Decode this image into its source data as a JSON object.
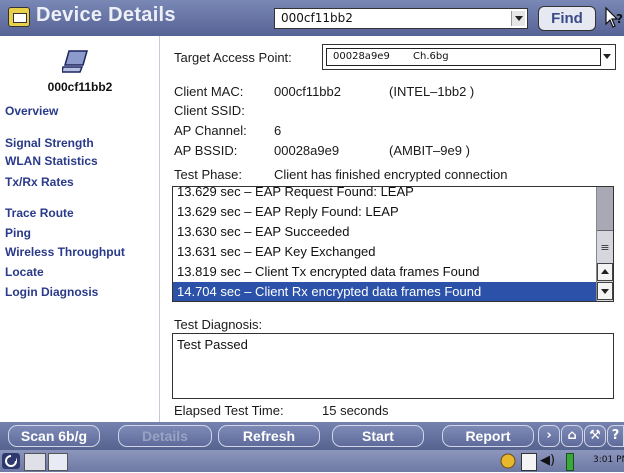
{
  "app": {
    "title": "Device Details",
    "device_select_value": "000cf11bb2",
    "find_label": "Find",
    "help_glyph": "?"
  },
  "sidebar": {
    "device_name": "000cf11bb2",
    "items": [
      {
        "label": "Overview"
      },
      {
        "label": "Signal Strength"
      },
      {
        "label": "WLAN Statistics"
      },
      {
        "label": "Tx/Rx Rates"
      },
      {
        "label": "Trace Route"
      },
      {
        "label": "Ping"
      },
      {
        "label": "Wireless Throughput"
      },
      {
        "label": "Locate"
      },
      {
        "label": "Login Diagnosis"
      }
    ]
  },
  "main": {
    "target_ap_label": "Target Access Point:",
    "target_ap_bssid": "00028a9e9",
    "target_ap_channel": "Ch.6bg",
    "fields": [
      {
        "label": "Client MAC:",
        "value": "000cf11bb2",
        "extra": "(INTEL–1bb2  )"
      },
      {
        "label": "Client SSID:",
        "value": "",
        "extra": ""
      },
      {
        "label": "AP Channel:",
        "value": "6",
        "extra": ""
      },
      {
        "label": "AP BSSID:",
        "value": "00028a9e9",
        "extra": "(AMBIT–9e9   )"
      }
    ],
    "test_phase_label": "Test Phase:",
    "test_phase_value": "Client has finished encrypted connection",
    "log": [
      "13.629 sec – EAP Request Found: LEAP",
      "13.629 sec – EAP Reply Found: LEAP",
      "13.630 sec – EAP Succeeded",
      "13.631 sec – EAP Key Exchanged",
      "13.819 sec – Client Tx encrypted data frames Found",
      "14.704 sec – Client Rx encrypted data frames Found"
    ],
    "selected_log_index": 5,
    "diagnosis_label": "Test Diagnosis:",
    "diagnosis_text": "Test Passed",
    "elapsed_label": "Elapsed Test Time:",
    "elapsed_value": "15 seconds"
  },
  "toolbar": {
    "scan_label": "Scan 6b/g",
    "details_label": "Details",
    "refresh_label": "Refresh",
    "start_label": "Start",
    "report_label": "Report",
    "icons": [
      "forward-icon",
      "home-icon",
      "wrench-icon",
      "help-icon"
    ]
  },
  "taskbar": {
    "clock": "3:01 PM"
  },
  "colors": {
    "title_bar": "#5c699a",
    "selection": "#2b52a8",
    "nav_text": "#2a3a8a"
  }
}
